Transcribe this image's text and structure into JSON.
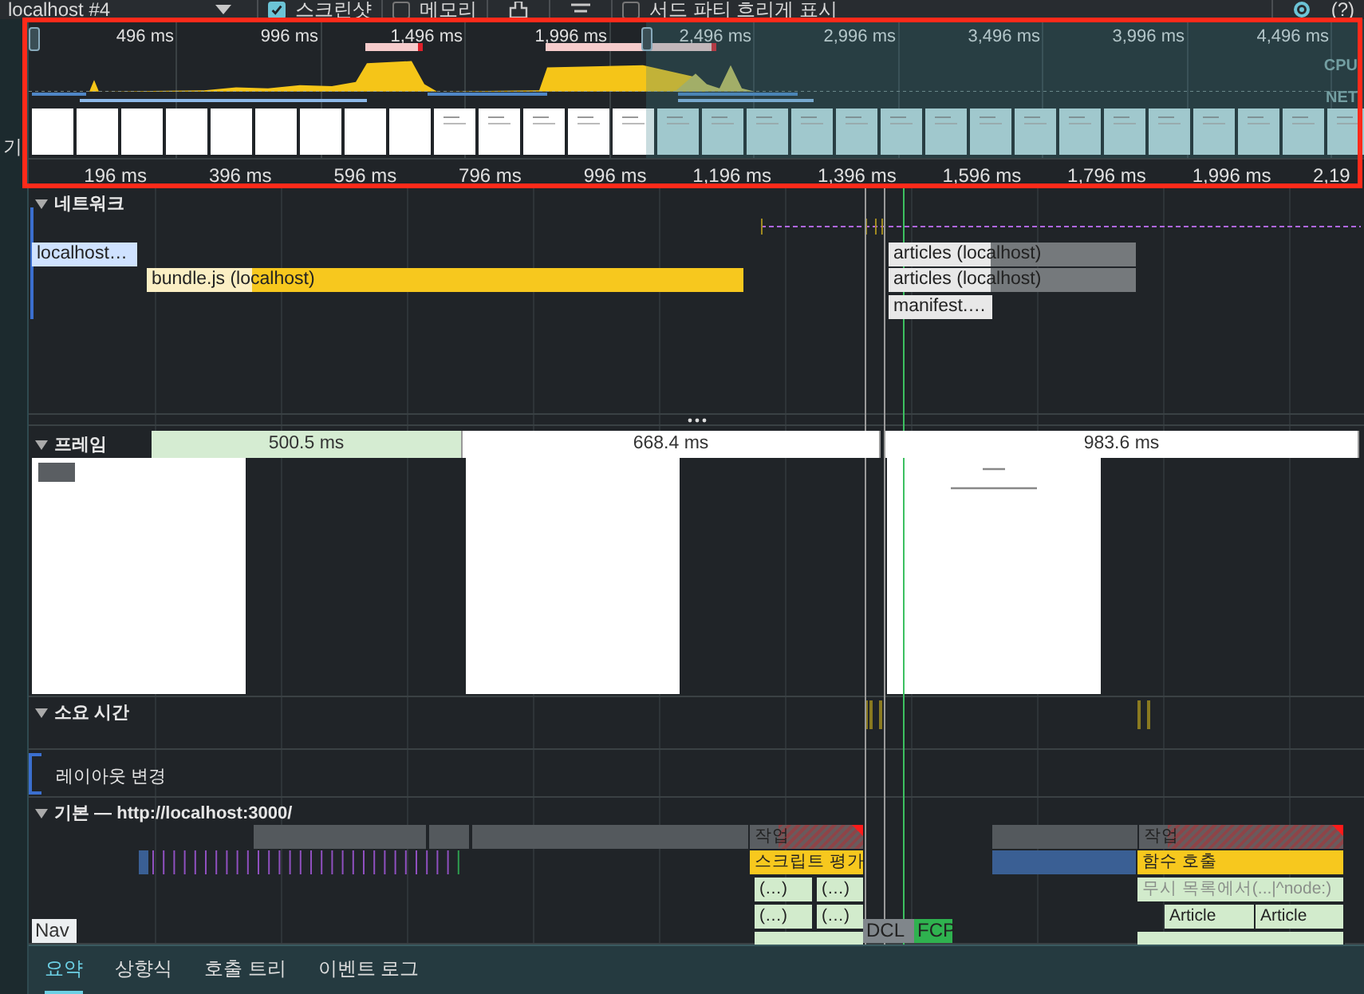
{
  "toolbar": {
    "recording": "localhost #4",
    "checkboxes": [
      {
        "label": "스크린샷",
        "checked": true
      },
      {
        "label": "메모리",
        "checked": false
      },
      {
        "label": "서드 파티 흐리게 표시",
        "checked": false
      }
    ],
    "help": "(?)"
  },
  "sidebar": {
    "text": "기"
  },
  "overview": {
    "time_labels": [
      "496 ms",
      "996 ms",
      "1,496 ms",
      "1,996 ms",
      "2,496 ms",
      "2,996 ms",
      "3,496 ms",
      "3,996 ms",
      "4,496 ms"
    ],
    "lane_labels": [
      "CPU",
      "NET"
    ],
    "ruler": [
      "196 ms",
      "396 ms",
      "596 ms",
      "796 ms",
      "996 ms",
      "1,196 ms",
      "1,396 ms",
      "1,596 ms",
      "1,796 ms",
      "1,996 ms",
      "2,19"
    ]
  },
  "network": {
    "title": "네트워크",
    "expanded": true,
    "requests": [
      {
        "label": "localhost…",
        "kind": "document"
      },
      {
        "label": "bundle.js (localhost)",
        "kind": "script"
      },
      {
        "label": "articles (localhost)",
        "kind": "fetch"
      },
      {
        "label": "articles (localhost)",
        "kind": "fetch"
      },
      {
        "label": "manifest.…",
        "kind": "other"
      }
    ]
  },
  "frames": {
    "title": "프레임",
    "expanded": true,
    "segments": [
      {
        "label": "500.5 ms",
        "kind": "idle"
      },
      {
        "label": "668.4 ms",
        "kind": "complete"
      },
      {
        "label": "983.6 ms",
        "kind": "complete"
      }
    ]
  },
  "timings": {
    "title": "소요 시간",
    "expanded": true
  },
  "layout_shifts": {
    "title": "레이아웃 변경"
  },
  "main": {
    "title": "기본 — http://localhost:3000/",
    "expanded": true,
    "rows": [
      {
        "entries": [
          {
            "kind": "task"
          },
          {
            "kind": "task"
          },
          {
            "kind": "task"
          },
          {
            "kind": "long-task",
            "label": "작업"
          },
          {
            "kind": "task"
          },
          {
            "kind": "long-task",
            "label": "작업"
          }
        ]
      },
      {
        "entries": [
          {
            "kind": "parse"
          },
          {
            "kind": "script",
            "label": "스크립트 평가"
          },
          {
            "kind": "parse"
          },
          {
            "kind": "script",
            "label": "함수 호출"
          }
        ]
      },
      {
        "entries": [
          {
            "kind": "call",
            "label": "(…)"
          },
          {
            "kind": "call",
            "label": "(…)"
          },
          {
            "kind": "ignored",
            "label": "무시 목록에서(...|^node:)"
          }
        ]
      },
      {
        "entries": [
          {
            "kind": "call",
            "label": "(…)"
          },
          {
            "kind": "call",
            "label": "(…)"
          },
          {
            "kind": "call",
            "label": "Article"
          },
          {
            "kind": "call",
            "label": "Article"
          }
        ]
      }
    ],
    "markers": [
      {
        "label": "Nav",
        "kind": "nav"
      },
      {
        "label": "DCL",
        "kind": "dcl"
      },
      {
        "label": "FCP",
        "kind": "fcp"
      }
    ]
  },
  "bottom_tabs": [
    {
      "label": "요약",
      "selected": true
    },
    {
      "label": "상향식",
      "selected": false
    },
    {
      "label": "호출 트리",
      "selected": false
    },
    {
      "label": "이벤트 로그",
      "selected": false
    }
  ]
}
